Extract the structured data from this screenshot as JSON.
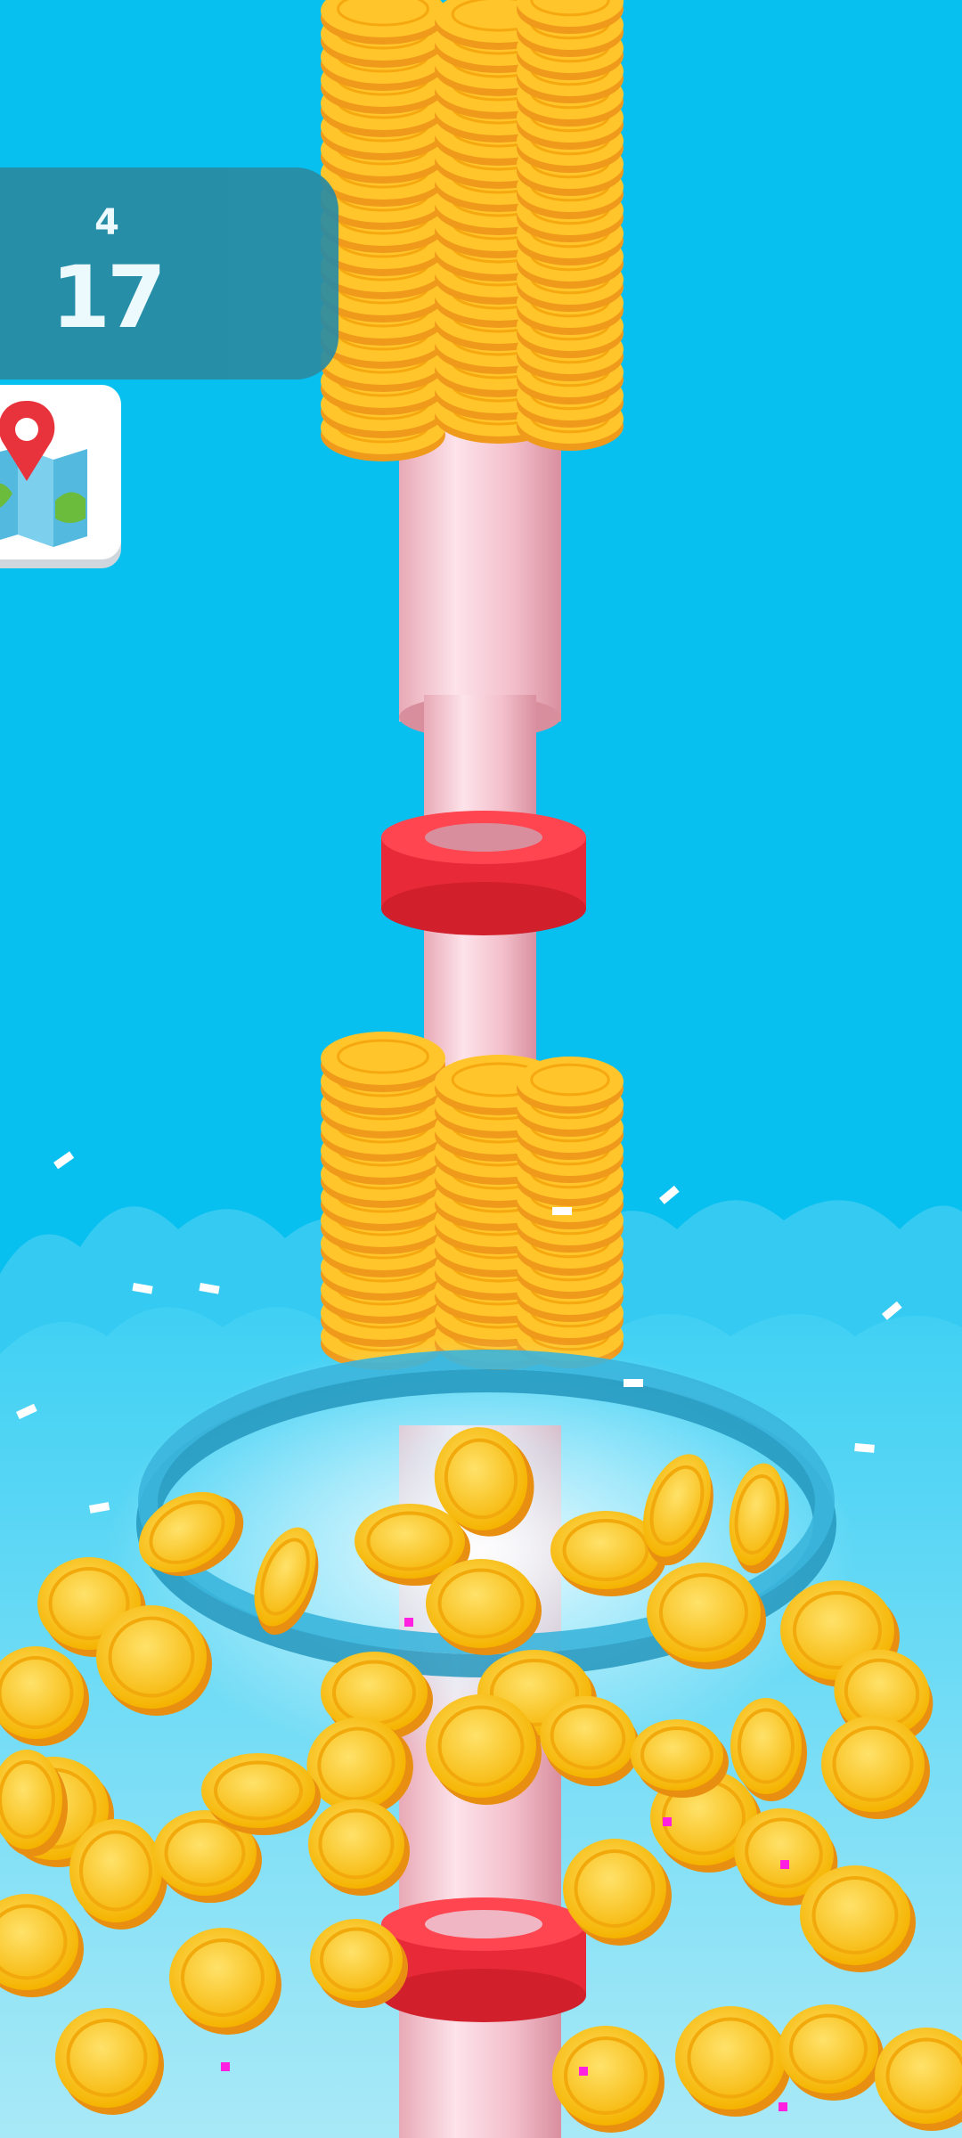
{
  "hud": {
    "level_label": "4",
    "score": "17"
  },
  "icons": {
    "map": "map-icon",
    "location_pin": "location-pin-icon"
  },
  "colors": {
    "sky": "#08c0ef",
    "pole": "#f6c6d0",
    "ring": "#ff3b48",
    "coin": "#ffc21a",
    "hud_panel": "#2a8ba3"
  }
}
